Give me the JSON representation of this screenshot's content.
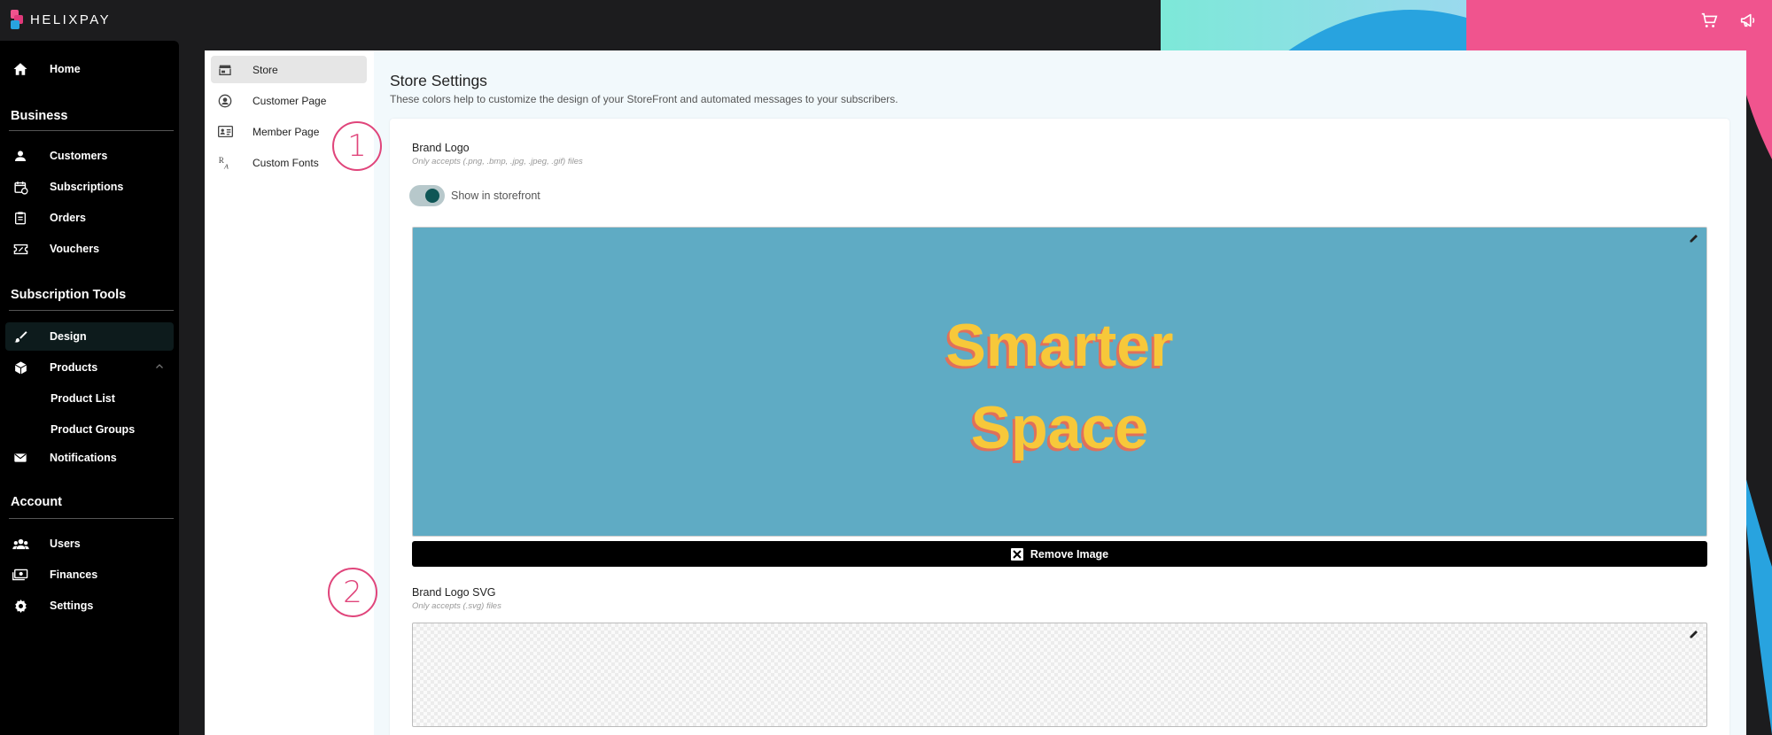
{
  "brand": {
    "name": "HELIXPAY"
  },
  "colors": {
    "accent_pink": "#f0548e",
    "accent_blue": "#28a3df",
    "accent_teal": "#7de8d8",
    "toggle_on": "#0f5656",
    "logo_bg": "#5fabc4",
    "logo_text": "#f7c83a",
    "annotation": "#e0457b"
  },
  "topbar": {
    "icons": [
      "cart-icon",
      "megaphone-icon"
    ]
  },
  "sidebar": {
    "home": "Home",
    "sections": [
      {
        "title": "Business",
        "items": [
          "Customers",
          "Subscriptions",
          "Orders",
          "Vouchers"
        ]
      },
      {
        "title": "Subscription Tools",
        "items": [
          "Design",
          "Products",
          "Product List",
          "Product Groups",
          "Notifications"
        ]
      },
      {
        "title": "Account",
        "items": [
          "Users",
          "Finances",
          "Settings"
        ]
      }
    ],
    "active_item": "Design"
  },
  "subnav": {
    "items": [
      "Store",
      "Customer Page",
      "Member Page",
      "Custom Fonts"
    ],
    "active_item": "Store"
  },
  "main": {
    "title": "Store Settings",
    "description": "These colors help to customize the design of your StoreFront and automated messages to your subscribers.",
    "brand_logo": {
      "label": "Brand Logo",
      "hint": "Only accepts (.png, .bmp, .jpg, .jpeg, .gif) files",
      "toggle_label": "Show in storefront",
      "toggle_on": true,
      "image_text": [
        "Smarter",
        "Space"
      ],
      "remove_label": "Remove Image"
    },
    "brand_logo_svg": {
      "label": "Brand Logo SVG",
      "hint": "Only accepts (.svg) files"
    }
  },
  "annotations": [
    "1",
    "2"
  ]
}
